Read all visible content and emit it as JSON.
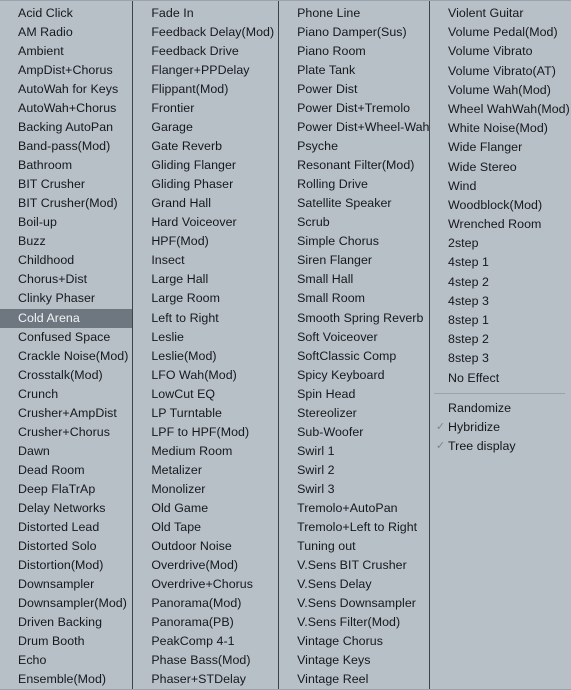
{
  "menu": {
    "background_color": "#b7bfc7",
    "selected_color": "#6e7780",
    "separator_color": "#3c4349",
    "columns": [
      {
        "name": "column-1",
        "items": [
          {
            "label": "Acid Click"
          },
          {
            "label": "AM Radio"
          },
          {
            "label": "Ambient"
          },
          {
            "label": "AmpDist+Chorus"
          },
          {
            "label": "AutoWah for Keys"
          },
          {
            "label": "AutoWah+Chorus"
          },
          {
            "label": "Backing AutoPan"
          },
          {
            "label": "Band-pass(Mod)"
          },
          {
            "label": "Bathroom"
          },
          {
            "label": "BIT Crusher"
          },
          {
            "label": "BIT Crusher(Mod)"
          },
          {
            "label": "Boil-up"
          },
          {
            "label": "Buzz"
          },
          {
            "label": "Childhood"
          },
          {
            "label": "Chorus+Dist"
          },
          {
            "label": "Clinky Phaser"
          },
          {
            "label": "Cold Arena",
            "selected": true
          },
          {
            "label": "Confused Space"
          },
          {
            "label": "Crackle Noise(Mod)"
          },
          {
            "label": "Crosstalk(Mod)"
          },
          {
            "label": "Crunch"
          },
          {
            "label": "Crusher+AmpDist"
          },
          {
            "label": "Crusher+Chorus"
          },
          {
            "label": "Dawn"
          },
          {
            "label": "Dead Room"
          },
          {
            "label": "Deep FlaTrAp"
          },
          {
            "label": "Delay Networks"
          },
          {
            "label": "Distorted Lead"
          },
          {
            "label": "Distorted Solo"
          },
          {
            "label": "Distortion(Mod)"
          },
          {
            "label": "Downsampler"
          },
          {
            "label": "Downsampler(Mod)"
          },
          {
            "label": "Driven Backing"
          },
          {
            "label": "Drum Booth"
          },
          {
            "label": "Echo"
          },
          {
            "label": "Ensemble(Mod)"
          }
        ]
      },
      {
        "name": "column-2",
        "items": [
          {
            "label": "Fade In"
          },
          {
            "label": "Feedback Delay(Mod)"
          },
          {
            "label": "Feedback Drive"
          },
          {
            "label": "Flanger+PPDelay"
          },
          {
            "label": "Flippant(Mod)"
          },
          {
            "label": "Frontier"
          },
          {
            "label": "Garage"
          },
          {
            "label": "Gate Reverb"
          },
          {
            "label": "Gliding Flanger"
          },
          {
            "label": "Gliding Phaser"
          },
          {
            "label": "Grand Hall"
          },
          {
            "label": "Hard Voiceover"
          },
          {
            "label": "HPF(Mod)"
          },
          {
            "label": "Insect"
          },
          {
            "label": "Large Hall"
          },
          {
            "label": "Large Room"
          },
          {
            "label": "Left to Right"
          },
          {
            "label": "Leslie"
          },
          {
            "label": "Leslie(Mod)"
          },
          {
            "label": "LFO Wah(Mod)"
          },
          {
            "label": "LowCut EQ"
          },
          {
            "label": "LP Turntable"
          },
          {
            "label": "LPF to HPF(Mod)"
          },
          {
            "label": "Medium Room"
          },
          {
            "label": "Metalizer"
          },
          {
            "label": "Monolizer"
          },
          {
            "label": "Old Game"
          },
          {
            "label": "Old Tape"
          },
          {
            "label": "Outdoor Noise"
          },
          {
            "label": "Overdrive(Mod)"
          },
          {
            "label": "Overdrive+Chorus"
          },
          {
            "label": "Panorama(Mod)"
          },
          {
            "label": "Panorama(PB)"
          },
          {
            "label": "PeakComp 4-1"
          },
          {
            "label": "Phase Bass(Mod)"
          },
          {
            "label": "Phaser+STDelay"
          }
        ]
      },
      {
        "name": "column-3",
        "items": [
          {
            "label": "Phone Line"
          },
          {
            "label": "Piano Damper(Sus)"
          },
          {
            "label": "Piano Room"
          },
          {
            "label": "Plate Tank"
          },
          {
            "label": "Power Dist"
          },
          {
            "label": "Power Dist+Tremolo"
          },
          {
            "label": "Power Dist+Wheel-Wah"
          },
          {
            "label": "Psyche"
          },
          {
            "label": "Resonant Filter(Mod)"
          },
          {
            "label": "Rolling Drive"
          },
          {
            "label": "Satellite Speaker"
          },
          {
            "label": "Scrub"
          },
          {
            "label": "Simple Chorus"
          },
          {
            "label": "Siren Flanger"
          },
          {
            "label": "Small Hall"
          },
          {
            "label": "Small Room"
          },
          {
            "label": "Smooth Spring Reverb"
          },
          {
            "label": "Soft Voiceover"
          },
          {
            "label": "SoftClassic Comp"
          },
          {
            "label": "Spicy Keyboard"
          },
          {
            "label": "Spin Head"
          },
          {
            "label": "Stereolizer"
          },
          {
            "label": "Sub-Woofer"
          },
          {
            "label": "Swirl 1"
          },
          {
            "label": "Swirl 2"
          },
          {
            "label": "Swirl 3"
          },
          {
            "label": "Tremolo+AutoPan"
          },
          {
            "label": "Tremolo+Left to Right"
          },
          {
            "label": "Tuning out"
          },
          {
            "label": "V.Sens BIT Crusher"
          },
          {
            "label": "V.Sens Delay"
          },
          {
            "label": "V.Sens Downsampler"
          },
          {
            "label": "V.Sens Filter(Mod)"
          },
          {
            "label": "Vintage Chorus"
          },
          {
            "label": "Vintage Keys"
          },
          {
            "label": "Vintage Reel"
          }
        ]
      },
      {
        "name": "column-4",
        "items": [
          {
            "label": "Violent Guitar"
          },
          {
            "label": "Volume Pedal(Mod)"
          },
          {
            "label": "Volume Vibrato"
          },
          {
            "label": "Volume Vibrato(AT)"
          },
          {
            "label": "Volume Wah(Mod)"
          },
          {
            "label": "Wheel WahWah(Mod)"
          },
          {
            "label": "White Noise(Mod)"
          },
          {
            "label": "Wide Flanger"
          },
          {
            "label": "Wide Stereo"
          },
          {
            "label": "Wind"
          },
          {
            "label": "Woodblock(Mod)"
          },
          {
            "label": "Wrenched Room"
          },
          {
            "label": "2step"
          },
          {
            "label": "4step 1"
          },
          {
            "label": "4step 2"
          },
          {
            "label": "4step 3"
          },
          {
            "label": "8step 1"
          },
          {
            "label": "8step 2"
          },
          {
            "label": "8step 3"
          },
          {
            "label": "No Effect"
          },
          {
            "separator": true
          },
          {
            "label": "Randomize"
          },
          {
            "label": "Hybridize",
            "checked": true,
            "check_glyph": "✓"
          },
          {
            "label": "Tree display",
            "checked": true,
            "check_glyph": "✓"
          }
        ]
      }
    ]
  }
}
